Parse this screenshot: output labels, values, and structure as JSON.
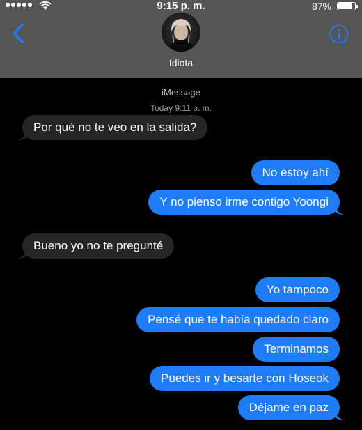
{
  "status_bar": {
    "time": "9:15 p. m.",
    "battery_percent": "87%",
    "battery_level": 0.87,
    "signal_bars": 5
  },
  "header": {
    "contact_name": "Idiota",
    "back_icon": "chevron-left-icon",
    "info_icon": "info-icon"
  },
  "thread": {
    "service_label": "iMessage",
    "timestamp": "Today 9:11 p. m.",
    "messages": [
      {
        "direction": "incoming",
        "text": "Por qué no te veo en la salida?"
      },
      {
        "direction": "outgoing",
        "text": "No estoy ahí"
      },
      {
        "direction": "outgoing",
        "text": "Y no pienso irme contigo Yoongi"
      },
      {
        "direction": "incoming",
        "text": "Bueno yo no te pregunté"
      },
      {
        "direction": "outgoing",
        "text": "Yo tampoco"
      },
      {
        "direction": "outgoing",
        "text": "Pensé que te había quedado claro"
      },
      {
        "direction": "outgoing",
        "text": "Terminamos"
      },
      {
        "direction": "outgoing",
        "text": "Puedes ir y besarte con Hoseok"
      },
      {
        "direction": "outgoing",
        "text": "Déjame en paz"
      }
    ]
  },
  "colors": {
    "header_bg": "#555556",
    "background": "#000000",
    "incoming_bubble": "#26252a",
    "outgoing_bubble": "#1e7cf8",
    "accent": "#1e7cf8"
  }
}
